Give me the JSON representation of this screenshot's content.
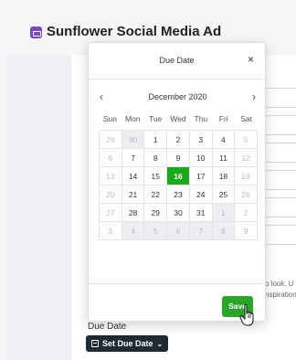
{
  "app": {
    "title": "Sunflower Social Media Ad"
  },
  "background": {
    "peek_text_1": "o look. U",
    "peek_text_2": "nspiration",
    "due_date_label": "Due Date",
    "set_due_date_button": "Set Due Date"
  },
  "modal": {
    "title": "Due Date",
    "close": "×",
    "month": "December 2020",
    "prev": "‹",
    "next": "›",
    "weekdays": [
      "Sun",
      "Mon",
      "Tue",
      "Wed",
      "Thu",
      "Fri",
      "Sat"
    ],
    "days": [
      [
        "29",
        "30",
        "1",
        "2",
        "3",
        "4",
        "5"
      ],
      [
        "6",
        "7",
        "8",
        "9",
        "10",
        "11",
        "12"
      ],
      [
        "13",
        "14",
        "15",
        "16",
        "17",
        "18",
        "19"
      ],
      [
        "20",
        "21",
        "22",
        "23",
        "24",
        "25",
        "26"
      ],
      [
        "27",
        "28",
        "29",
        "30",
        "31",
        "1",
        "2"
      ],
      [
        "3",
        "4",
        "5",
        "6",
        "7",
        "8",
        "9"
      ]
    ],
    "selected_day": "16",
    "save_label": "Save"
  },
  "colors": {
    "accent_green": "#1ea81e",
    "app_icon": "#7b4ab8",
    "dark_button": "#1f2a33"
  }
}
